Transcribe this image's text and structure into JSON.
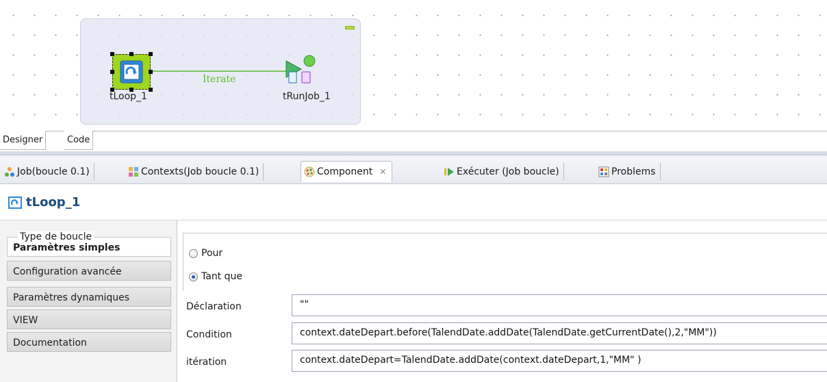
{
  "designer": {
    "subjob": {
      "color": "#e2e6f2"
    },
    "nodes": [
      {
        "label": "tLoop_1"
      },
      {
        "label": "tRunJob_1"
      }
    ],
    "link": {
      "label": "Iterate",
      "color": "#5bbd2a"
    },
    "tabs": [
      {
        "label": "Designer"
      },
      {
        "label": "Code"
      }
    ]
  },
  "view_tabs": [
    {
      "label": "Job(boucle 0.1)",
      "icon": "job-icon"
    },
    {
      "label": "Contexts(Job boucle 0.1)",
      "icon": "contexts-icon"
    },
    {
      "label": "Component",
      "icon": "component-icon",
      "active": true
    },
    {
      "label": "Exécuter (Job boucle)",
      "icon": "run-icon"
    },
    {
      "label": "Problems",
      "icon": "problems-icon"
    }
  ],
  "component": {
    "title": "tLoop_1",
    "icon": "tloop-icon"
  },
  "settings_nav": [
    {
      "label": "Paramètres simples",
      "active": true
    },
    {
      "label": "Configuration avancée"
    },
    {
      "label": "Paramètres dynamiques"
    },
    {
      "label": "VIEW"
    },
    {
      "label": "Documentation"
    }
  ],
  "loop_type": {
    "legend": "Type de boucle",
    "options": [
      {
        "label": "Pour",
        "selected": false
      },
      {
        "label": "Tant que",
        "selected": true
      }
    ]
  },
  "fields": [
    {
      "label": "Déclaration",
      "value": "\"\""
    },
    {
      "label": "Condition",
      "value": "context.dateDepart.before(TalendDate.addDate(TalendDate.getCurrentDate(),2,\"MM\"))"
    },
    {
      "label": "itération",
      "value": "context.dateDepart=TalendDate.addDate(context.dateDepart,1,\"MM\" )"
    }
  ]
}
